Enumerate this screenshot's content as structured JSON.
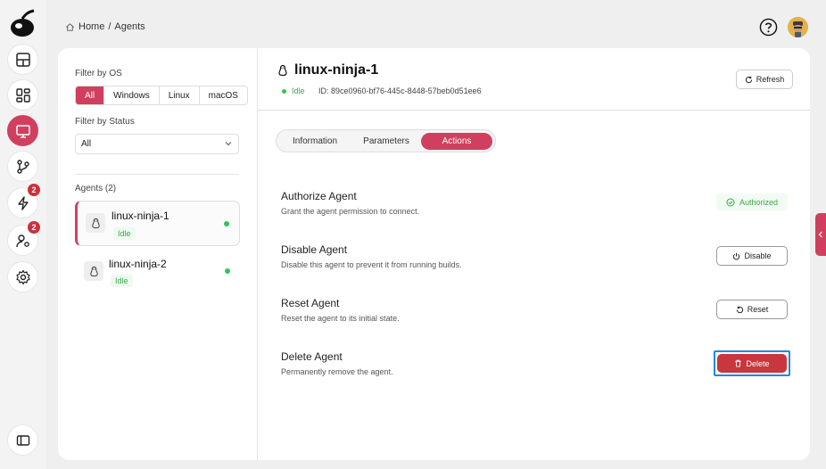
{
  "breadcrumb": {
    "home": "Home",
    "separator": "/",
    "current": "Agents"
  },
  "filters": {
    "os_label": "Filter by OS",
    "os_options": [
      "All",
      "Windows",
      "Linux",
      "macOS"
    ],
    "status_label": "Filter by Status",
    "status_value": "All"
  },
  "agents": {
    "header": "Agents (2)",
    "items": [
      {
        "name": "linux-ninja-1",
        "status": "Idle"
      },
      {
        "name": "linux-ninja-2",
        "status": "Idle"
      }
    ]
  },
  "rail": {
    "badges": [
      "2",
      "2"
    ]
  },
  "detail": {
    "name": "linux-ninja-1",
    "status": "Idle",
    "id": "ID: 89ce0960-bf76-445c-8448-57beb0d51ee6",
    "refresh_label": "Refresh"
  },
  "tabs": [
    "Information",
    "Parameters",
    "Actions"
  ],
  "actions": [
    {
      "title": "Authorize Agent",
      "desc": "Grant the agent permission to connect.",
      "button": "Authorized"
    },
    {
      "title": "Disable Agent",
      "desc": "Disable this agent to prevent it from running builds.",
      "button": "Disable"
    },
    {
      "title": "Reset Agent",
      "desc": "Reset the agent to its initial state.",
      "button": "Reset"
    },
    {
      "title": "Delete Agent",
      "desc": "Permanently remove the agent.",
      "button": "Delete"
    }
  ],
  "colors": {
    "accent": "#d0405e",
    "success": "#3aa84e",
    "danger": "#c9363d",
    "focus": "#1e88e5"
  }
}
